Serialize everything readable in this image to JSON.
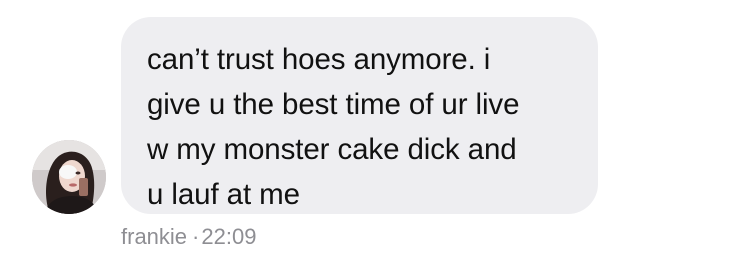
{
  "message": {
    "lines": [
      "can’t trust hoes anymore. i",
      "give u the best time of ur live",
      "w my monster cake dick and",
      "u lauf at me"
    ],
    "sender": "frankie",
    "separator": "·",
    "time": "22:09"
  },
  "colors": {
    "bubble": "#eeeef1",
    "text": "#111111",
    "meta": "#8e8e93"
  }
}
